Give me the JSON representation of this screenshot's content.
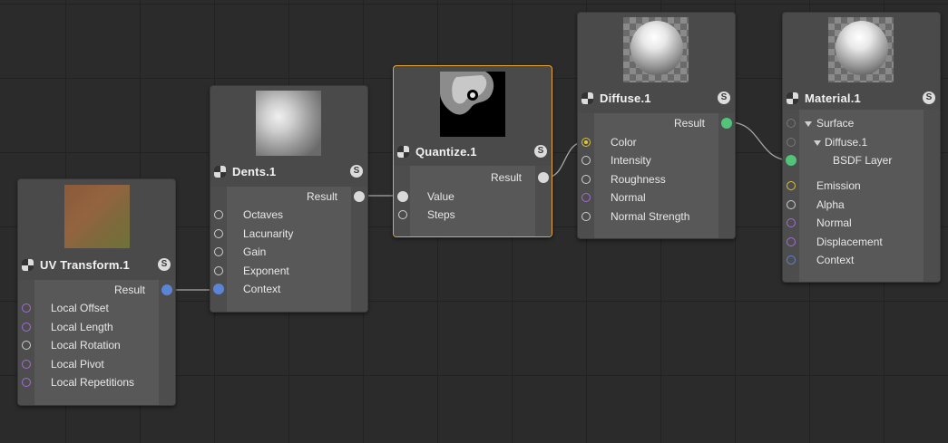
{
  "colors": {
    "canvas": "#2b2b2b",
    "node_body": "#585858",
    "selected_border": "#e8a63a",
    "port_purple": "#a36cd6",
    "port_blue": "#5b84d6",
    "port_green": "#52c47a",
    "port_yellow": "#d8c237",
    "port_gray": "#cfcfcf"
  },
  "nodes": {
    "uv_transform": {
      "title": "UV Transform.1",
      "badge": "S",
      "output": "Result",
      "inputs": [
        "Local Offset",
        "Local Length",
        "Local Rotation",
        "Local Pivot",
        "Local Repetitions"
      ]
    },
    "dents": {
      "title": "Dents.1",
      "badge": "S",
      "output": "Result",
      "inputs": [
        "Octaves",
        "Lacunarity",
        "Gain",
        "Exponent",
        "Context"
      ]
    },
    "quantize": {
      "title": "Quantize.1",
      "badge": "S",
      "output": "Result",
      "inputs": [
        "Value",
        "Steps"
      ]
    },
    "diffuse": {
      "title": "Diffuse.1",
      "badge": "S",
      "output": "Result",
      "inputs": [
        "Color",
        "Intensity",
        "Roughness",
        "Normal",
        "Normal Strength"
      ]
    },
    "material": {
      "title": "Material.1",
      "badge": "S",
      "inputs": [
        "Surface",
        "Diffuse.1",
        "BSDF Layer",
        "Emission",
        "Alpha",
        "Normal",
        "Displacement",
        "Context"
      ]
    }
  }
}
